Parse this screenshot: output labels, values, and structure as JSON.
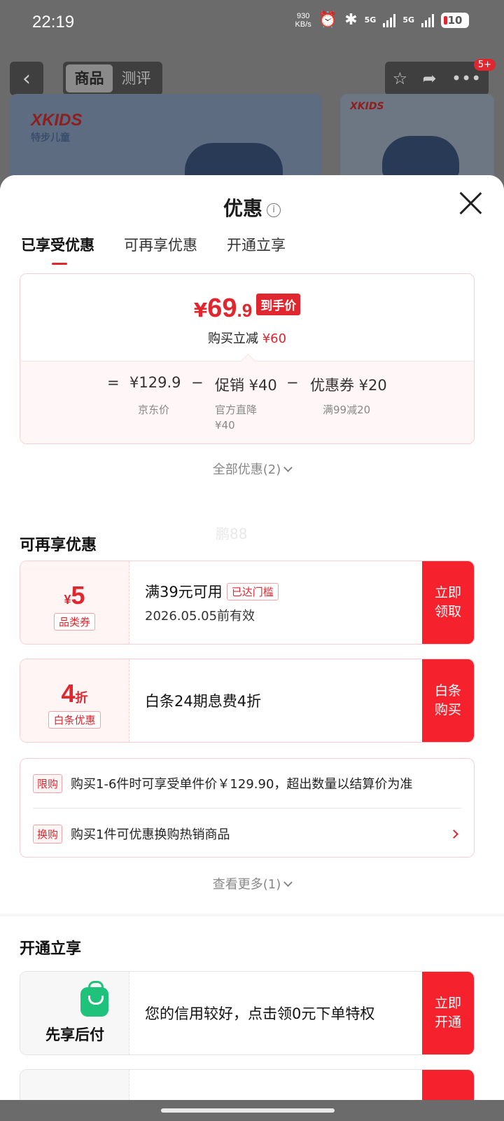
{
  "status": {
    "time": "22:19",
    "net_speed": "930",
    "net_unit": "KB/s",
    "sig1": "5G",
    "sig2": "5G",
    "battery": "10"
  },
  "topbar": {
    "tab_product": "商品",
    "tab_review": "测评",
    "badge": "5+"
  },
  "hero": {
    "brand": "XKIDS",
    "brand_sub": "特步儿童"
  },
  "sheet": {
    "title": "优惠",
    "info_icon": "i"
  },
  "tabs": [
    "已享受优惠",
    "可再享优惠",
    "开通立享"
  ],
  "price_card": {
    "yen": "¥",
    "price_int": "69",
    "price_dec": ".9",
    "final_tag": "到手价",
    "reduce_label": "购买立减",
    "reduce_amount": "¥60",
    "formula": {
      "eq": "=",
      "jd_price": "¥129.9",
      "minus1": "−",
      "promo": "促销 ¥40",
      "minus2": "−",
      "coupon": "优惠券 ¥20",
      "jd_label": "京东价",
      "promo_label_1": "官方直降",
      "promo_label_2": "¥40",
      "coupon_label": "满99减20"
    }
  },
  "all_discount": "全部优惠(2)",
  "more_section": {
    "title": "可再享优惠",
    "watermark": "鹏88",
    "coupons": [
      {
        "yen": "¥",
        "value": "5",
        "unit": "",
        "tag": "品类券",
        "main": "满39元可用",
        "reached": "已达门槛",
        "sub": "2026.05.05前有效",
        "btn": "立即\n领取"
      },
      {
        "yen": "",
        "value": "4",
        "unit": "折",
        "tag": "白条优惠",
        "main": "白条24期息费4折",
        "reached": "",
        "sub": "",
        "btn": "白条\n购买"
      }
    ],
    "rules": [
      {
        "tag": "限购",
        "text": "购买1-6件时可享受单件价￥129.90，超出数量以结算价为准"
      },
      {
        "tag": "换购",
        "text": "购买1件可优惠换购热销商品"
      }
    ],
    "see_more": "查看更多(1)"
  },
  "open_section": {
    "title": "开通立享",
    "bnpl_label": "先享后付",
    "bnpl_text": "您的信用较好，点击领0元下单特权",
    "bnpl_btn": "立即\n开通"
  },
  "colors": {
    "accent": "#e0262e",
    "button": "#f5222d",
    "bnpl_green": "#1fc27a"
  }
}
